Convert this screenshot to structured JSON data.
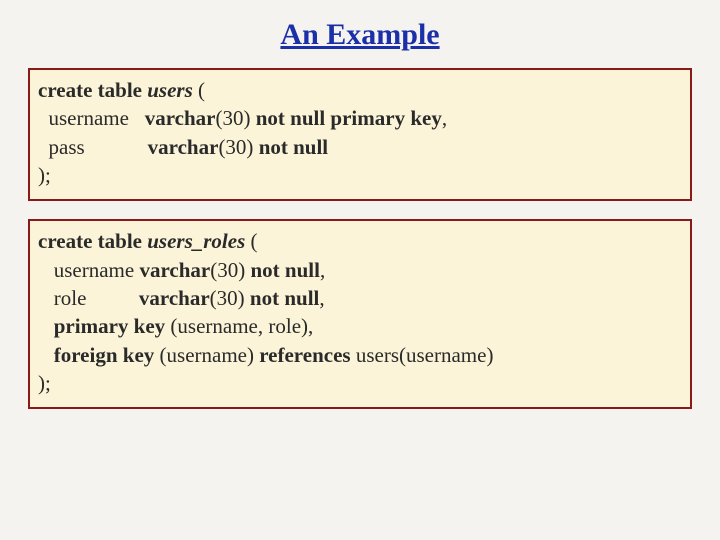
{
  "title": "An Example",
  "block1": {
    "l1_kw1": "create table ",
    "l1_ident": "users",
    "l1_plain": " (",
    "l2_plain1": "  username   ",
    "l2_kw": "varchar",
    "l2_plain2": "(30)",
    "l2_kw2": " not null primary key",
    "l2_plain3": ",",
    "l3_plain1": "  pass            ",
    "l3_kw": "varchar",
    "l3_plain2": "(30)",
    "l3_kw2": " not null",
    "l4": ");"
  },
  "block2": {
    "l1_kw1": "create table ",
    "l1_ident": "users_roles",
    "l1_plain": " (",
    "l2_plain1": "   username ",
    "l2_kw": "varchar",
    "l2_plain2": "(30)",
    "l2_kw2": " not null",
    "l2_plain3": ",",
    "l3_plain1": "   role          ",
    "l3_kw": "varchar",
    "l3_plain2": "(30)",
    "l3_kw2": " not null",
    "l3_plain3": ",",
    "l4_kw": "   primary key ",
    "l4_plain": "(username, role),",
    "l5_kw": "   foreign key ",
    "l5_plain1": "(username) ",
    "l5_kw2": "references ",
    "l5_plain2": "users(username)",
    "l6": ");"
  }
}
